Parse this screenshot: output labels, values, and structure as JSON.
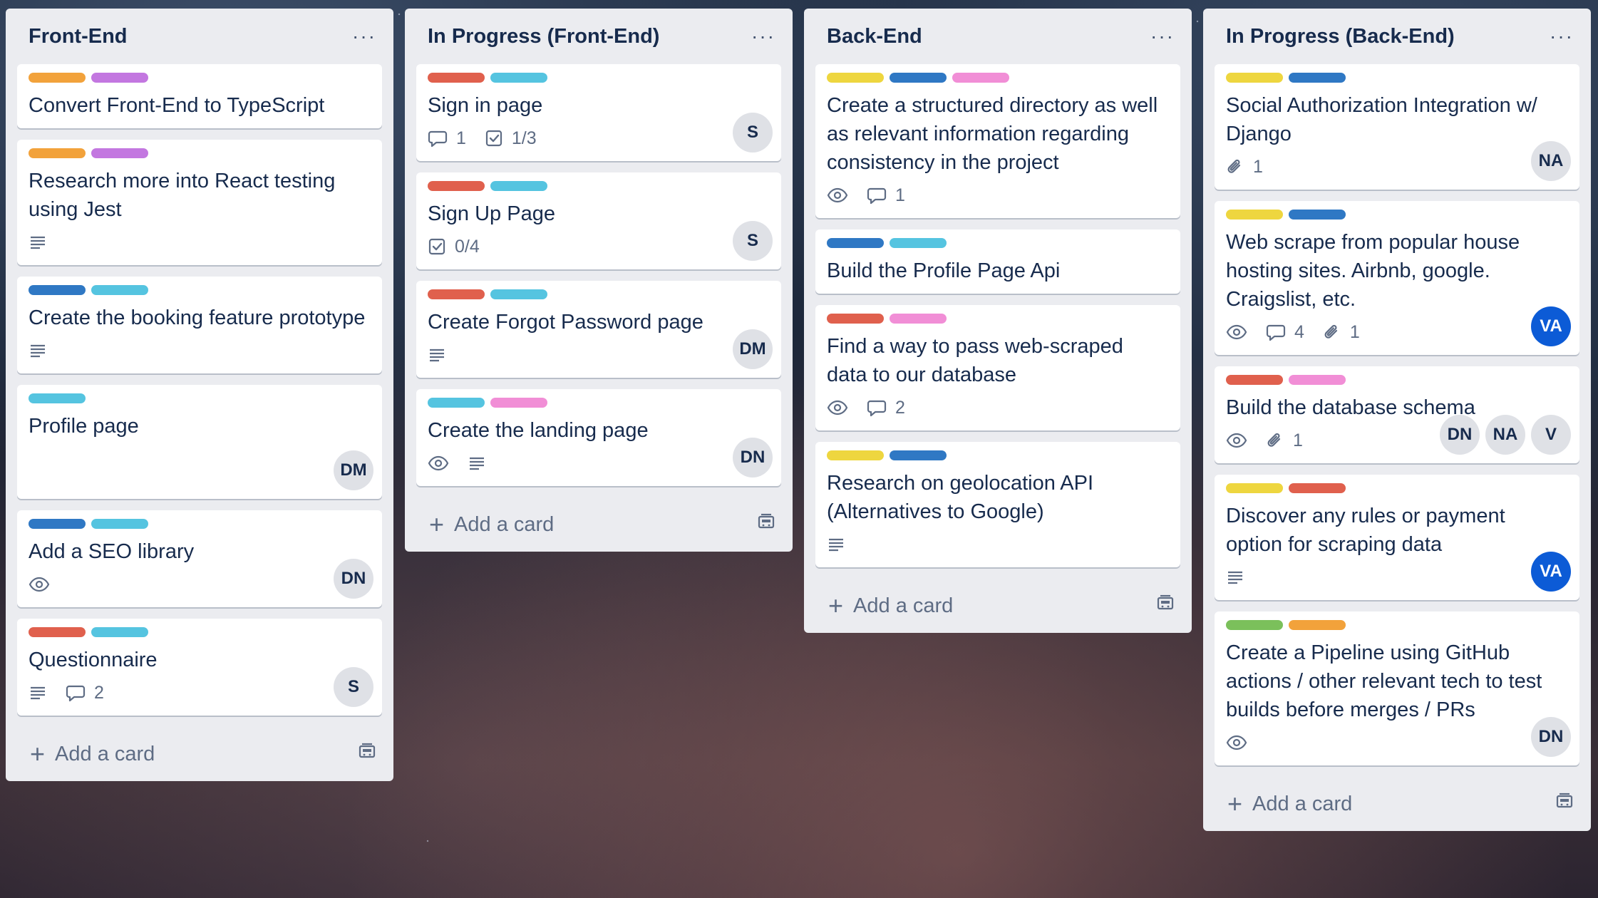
{
  "colors": {
    "orange": "#f2a23b",
    "purple": "#c377e0",
    "blue": "#2f78c4",
    "sky": "#55c4e0",
    "red": "#e0604d",
    "yellow": "#eed63f",
    "pink": "#f18ed6",
    "green": "#7bc05b"
  },
  "ui": {
    "add_card": "Add a card",
    "menu": "···"
  },
  "lists": [
    {
      "title": "Front-End",
      "cards": [
        {
          "labels": [
            "orange",
            "purple"
          ],
          "title": "Convert Front-End to TypeScript",
          "badges": [],
          "members": []
        },
        {
          "labels": [
            "orange",
            "purple"
          ],
          "title": "Research more into React testing using Jest",
          "badges": [
            {
              "icon": "description-icon",
              "text": ""
            }
          ],
          "members": []
        },
        {
          "labels": [
            "blue",
            "sky"
          ],
          "title": "Create the booking feature prototype",
          "badges": [
            {
              "icon": "description-icon",
              "text": ""
            }
          ],
          "members": []
        },
        {
          "labels": [
            "sky"
          ],
          "title": "Profile page",
          "badges": [],
          "members": [
            {
              "initials": "DM",
              "style": "gray"
            }
          ]
        },
        {
          "labels": [
            "blue",
            "sky"
          ],
          "title": "Add a SEO library",
          "badges": [
            {
              "icon": "watch-icon",
              "text": ""
            }
          ],
          "members": [
            {
              "initials": "DN",
              "style": "gray"
            }
          ]
        },
        {
          "labels": [
            "red",
            "sky"
          ],
          "title": "Questionnaire",
          "badges": [
            {
              "icon": "description-icon",
              "text": ""
            },
            {
              "icon": "comment-icon",
              "text": "2"
            }
          ],
          "members": [
            {
              "initials": "S",
              "style": "gray"
            }
          ]
        }
      ]
    },
    {
      "title": "In Progress (Front-End)",
      "cards": [
        {
          "labels": [
            "red",
            "sky"
          ],
          "title": "Sign in page",
          "badges": [
            {
              "icon": "comment-icon",
              "text": "1"
            },
            {
              "icon": "checklist-icon",
              "text": "1/3"
            }
          ],
          "members": [
            {
              "initials": "S",
              "style": "gray"
            }
          ]
        },
        {
          "labels": [
            "red",
            "sky"
          ],
          "title": "Sign Up Page",
          "badges": [
            {
              "icon": "checklist-icon",
              "text": "0/4"
            }
          ],
          "members": [
            {
              "initials": "S",
              "style": "gray"
            }
          ]
        },
        {
          "labels": [
            "red",
            "sky"
          ],
          "title": "Create Forgot Password page",
          "badges": [
            {
              "icon": "description-icon",
              "text": ""
            }
          ],
          "members": [
            {
              "initials": "DM",
              "style": "gray"
            }
          ]
        },
        {
          "labels": [
            "sky",
            "pink"
          ],
          "title": "Create the landing page",
          "badges": [
            {
              "icon": "watch-icon",
              "text": ""
            },
            {
              "icon": "description-icon",
              "text": ""
            }
          ],
          "members": [
            {
              "initials": "DN",
              "style": "gray"
            }
          ]
        }
      ]
    },
    {
      "title": "Back-End",
      "cards": [
        {
          "labels": [
            "yellow",
            "blue",
            "pink"
          ],
          "title": "Create a structured directory as well as relevant information regarding consistency in the project",
          "badges": [
            {
              "icon": "watch-icon",
              "text": ""
            },
            {
              "icon": "comment-icon",
              "text": "1"
            }
          ],
          "members": []
        },
        {
          "labels": [
            "blue",
            "sky"
          ],
          "title": "Build the Profile Page Api",
          "badges": [],
          "members": []
        },
        {
          "labels": [
            "red",
            "pink"
          ],
          "title": "Find a way to pass web-scraped data to our database",
          "badges": [
            {
              "icon": "watch-icon",
              "text": ""
            },
            {
              "icon": "comment-icon",
              "text": "2"
            }
          ],
          "members": []
        },
        {
          "labels": [
            "yellow",
            "blue"
          ],
          "title": "Research on geolocation API (Alternatives to Google)",
          "badges": [
            {
              "icon": "description-icon",
              "text": ""
            }
          ],
          "members": []
        }
      ]
    },
    {
      "title": "In Progress (Back-End)",
      "cards": [
        {
          "labels": [
            "yellow",
            "blue"
          ],
          "title": "Social Authorization Integration w/ Django",
          "badges": [
            {
              "icon": "attachment-icon",
              "text": "1"
            }
          ],
          "members": [
            {
              "initials": "NA",
              "style": "gray"
            }
          ]
        },
        {
          "labels": [
            "yellow",
            "blue"
          ],
          "title": "Web scrape from popular house hosting sites. Airbnb, google. Craigslist, etc.",
          "badges": [
            {
              "icon": "watch-icon",
              "text": ""
            },
            {
              "icon": "comment-icon",
              "text": "4"
            },
            {
              "icon": "attachment-icon",
              "text": "1"
            }
          ],
          "members": [
            {
              "initials": "VA",
              "style": "blue"
            }
          ]
        },
        {
          "labels": [
            "red",
            "pink"
          ],
          "title": "Build the database schema",
          "badges": [
            {
              "icon": "watch-icon",
              "text": ""
            },
            {
              "icon": "attachment-icon",
              "text": "1"
            }
          ],
          "members": [
            {
              "initials": "DN",
              "style": "gray"
            },
            {
              "initials": "NA",
              "style": "gray"
            },
            {
              "initials": "V",
              "style": "gray"
            }
          ]
        },
        {
          "labels": [
            "yellow",
            "red"
          ],
          "title": "Discover any rules or payment option for scraping data",
          "badges": [
            {
              "icon": "description-icon",
              "text": ""
            }
          ],
          "members": [
            {
              "initials": "VA",
              "style": "blue"
            }
          ]
        },
        {
          "labels": [
            "green",
            "orange"
          ],
          "title": "Create a Pipeline using GitHub actions / other relevant tech to test builds before merges / PRs",
          "badges": [
            {
              "icon": "watch-icon",
              "text": ""
            }
          ],
          "members": [
            {
              "initials": "DN",
              "style": "gray"
            }
          ]
        }
      ]
    }
  ]
}
